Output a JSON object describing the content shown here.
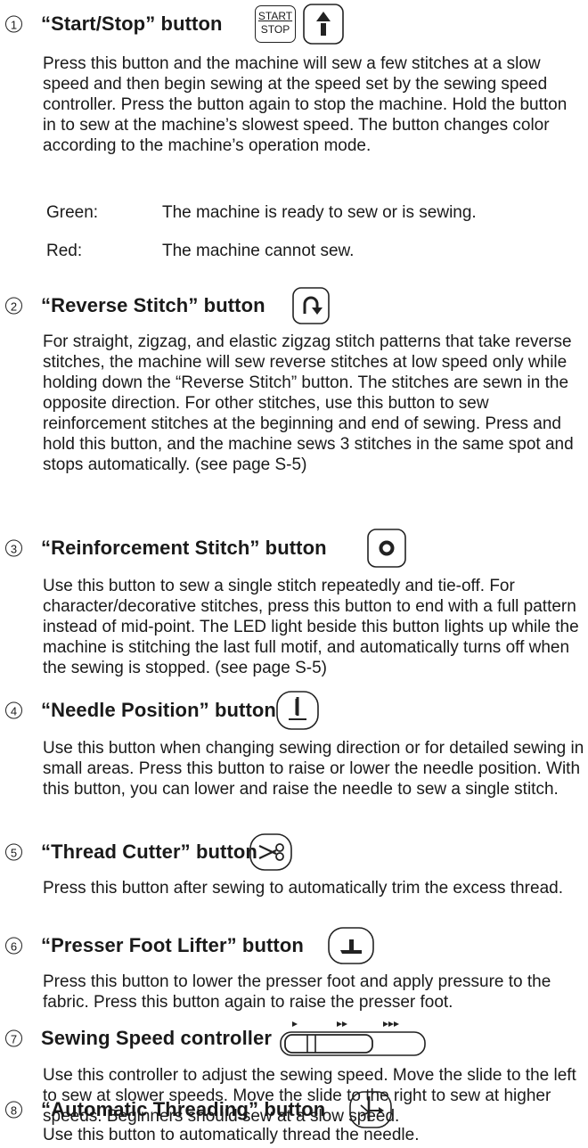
{
  "sections": [
    {
      "number": "1",
      "title": "“Start/Stop” button",
      "icon_text": [
        "START",
        "STOP"
      ],
      "body": "Press this button and the machine will sew a few stitches at a slow speed and then begin sewing at the speed set by the sewing speed controller. Press the button again to stop the machine. Hold the button in to sew at the machine’s slowest speed. The button changes color according to the machine’s operation mode.",
      "colors": [
        {
          "label": "Green:",
          "text": "The machine is ready to sew or is sewing."
        },
        {
          "label": "Red:",
          "text": "The machine cannot sew."
        }
      ]
    },
    {
      "number": "2",
      "title": "“Reverse Stitch” button",
      "body": "For straight, zigzag, and elastic zigzag stitch patterns that take reverse stitches, the machine will sew reverse stitches at low speed only while holding down the “Reverse Stitch” button. The stitches are sewn in the opposite direction. For other stitches, use this button to sew reinforcement stitches at the beginning and end of sewing. Press and hold this button, and the machine sews 3 stitches in the same spot and stops automatically. (see page S-5)"
    },
    {
      "number": "3",
      "title": "“Reinforcement Stitch” button",
      "body": "Use this button to sew a single stitch repeatedly and tie-off. For character/decorative stitches, press this button to end with a full pattern instead of mid-point. The LED light beside this button lights up while the machine is stitching the last full motif, and automatically turns off when the sewing is stopped. (see page S-5)"
    },
    {
      "number": "4",
      "title": "“Needle Position” button",
      "body": "Use this button when changing sewing direction or for detailed sewing in small areas. Press this button to raise or lower the needle position. With this button, you can lower and raise the needle to sew a single stitch."
    },
    {
      "number": "5",
      "title": "“Thread Cutter” button",
      "body": "Press this button after sewing to automatically trim the excess thread."
    },
    {
      "number": "6",
      "title": "“Presser Foot Lifter” button",
      "body": "Press this button to lower the presser foot and apply pressure to the fabric. Press this button again to raise the presser foot."
    },
    {
      "number": "7",
      "title": "Sewing Speed controller",
      "body": "Use this controller to adjust the sewing speed. Move the slide to the left to sew at slower speeds. Move the slide to the right to sew at higher speeds. Beginners should sew at a slow speed."
    },
    {
      "number": "8",
      "title": "“Automatic Threading” button",
      "body": "Use this button to automatically thread the needle."
    }
  ]
}
